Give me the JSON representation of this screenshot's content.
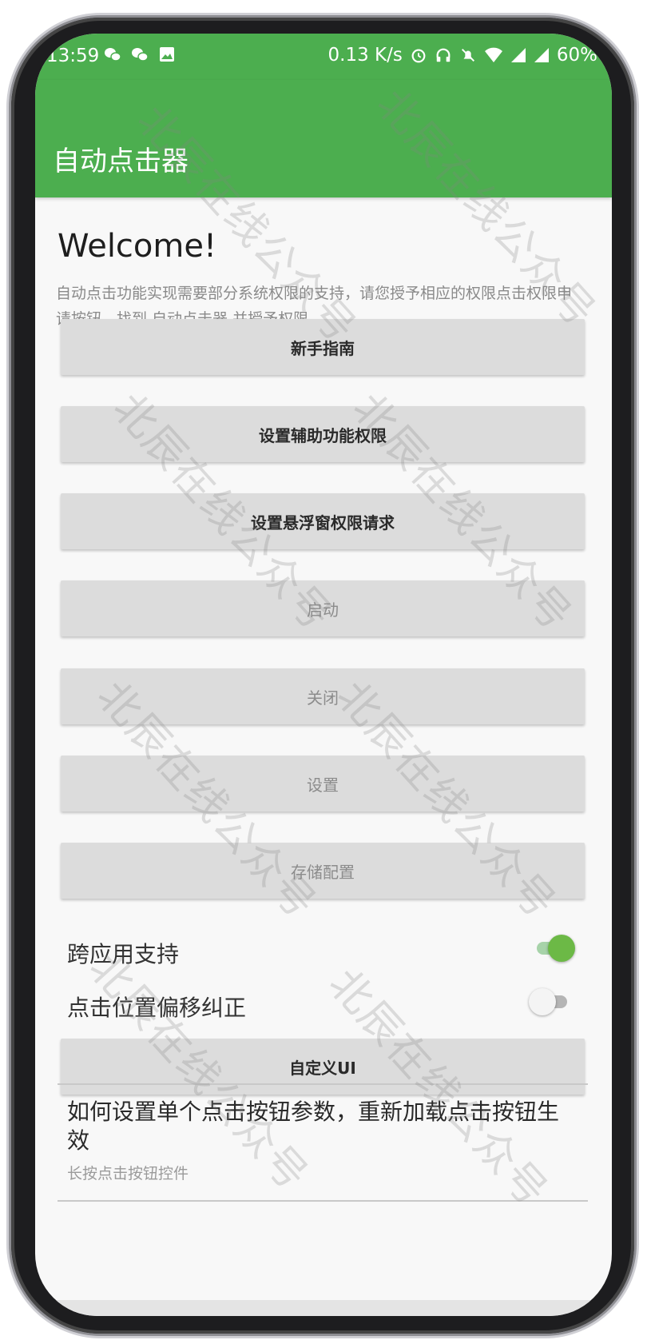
{
  "status_bar": {
    "time": "13:59",
    "network_speed": "0.13 K/s",
    "battery": "60%",
    "left_icons": [
      "wechat-icon",
      "wechat-icon",
      "image-icon"
    ],
    "right_icons": [
      "alarm-icon",
      "headset-icon",
      "mute-icon",
      "wifi-icon",
      "signal-icon",
      "signal-icon"
    ]
  },
  "app_bar": {
    "title": "自动点击器"
  },
  "content": {
    "welcome": "Welcome!",
    "description": "自动点击功能实现需要部分系统权限的支持，请您授予相应的权限点击权限申请按钮，找到 自动点击器 并授予权限",
    "buttons": [
      {
        "label": "新手指南",
        "enabled": true
      },
      {
        "label": "设置辅助功能权限",
        "enabled": true
      },
      {
        "label": "设置悬浮窗权限请求",
        "enabled": true
      },
      {
        "label": "启动",
        "enabled": false
      },
      {
        "label": "关闭",
        "enabled": false
      },
      {
        "label": "设置",
        "enabled": false
      },
      {
        "label": "存储配置",
        "enabled": false
      }
    ],
    "switches": [
      {
        "label": "跨应用支持",
        "on": true
      },
      {
        "label": "点击位置偏移纠正",
        "on": false
      }
    ],
    "custom_ui_button": "自定义UI",
    "help": {
      "title": "如何设置单个点击按钮参数，重新加载点击按钮生效",
      "subtitle": "长按点击按钮控件"
    }
  },
  "watermark": "北辰在线公众号",
  "colors": {
    "app_bar": "#4cae4f",
    "switch_on": "#6cb946",
    "button_bg": "#dcdcdc"
  }
}
